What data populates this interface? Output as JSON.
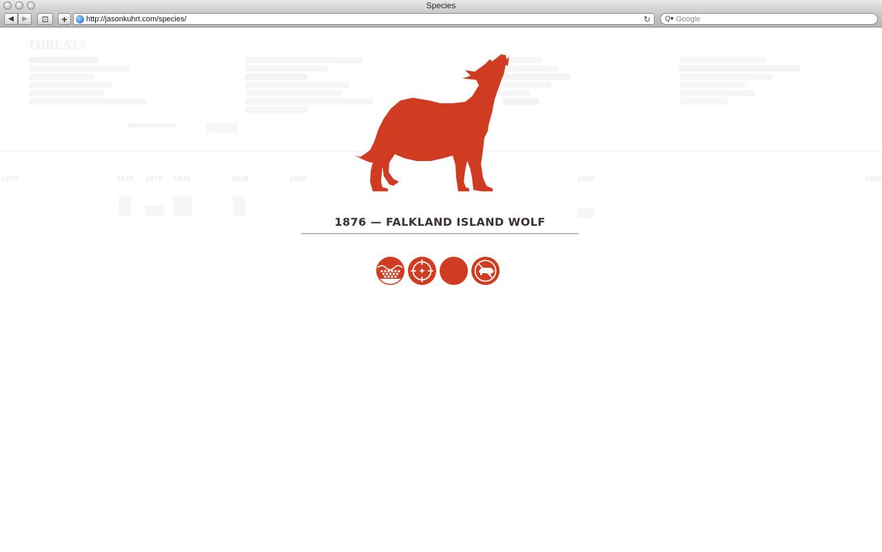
{
  "window": {
    "title": "Species"
  },
  "toolbar": {
    "back_glyph": "◀",
    "forward_glyph": "▶",
    "reader_glyph": "⊡",
    "add_glyph": "+",
    "url": "http://jasonkuhrt.com/species/",
    "reload_glyph": "↻",
    "search_glyph": "Q▾",
    "search_placeholder": "Google"
  },
  "background": {
    "heading": "THREATS",
    "timeline_years": [
      "1870",
      "1874",
      "1875",
      "1876",
      "1878",
      "1880",
      "1890",
      "1900"
    ]
  },
  "species": {
    "title": "1876 — FALKLAND ISLAND WOLF",
    "accent_color": "#d03c21",
    "threat_icons": [
      "hunting-fur-icon",
      "target-hunting-icon",
      "blank-threat-icon",
      "no-livestock-icon"
    ]
  },
  "colors": {
    "accent": "#d03c21",
    "title_text": "#3b3331",
    "rule": "#8a8582"
  }
}
